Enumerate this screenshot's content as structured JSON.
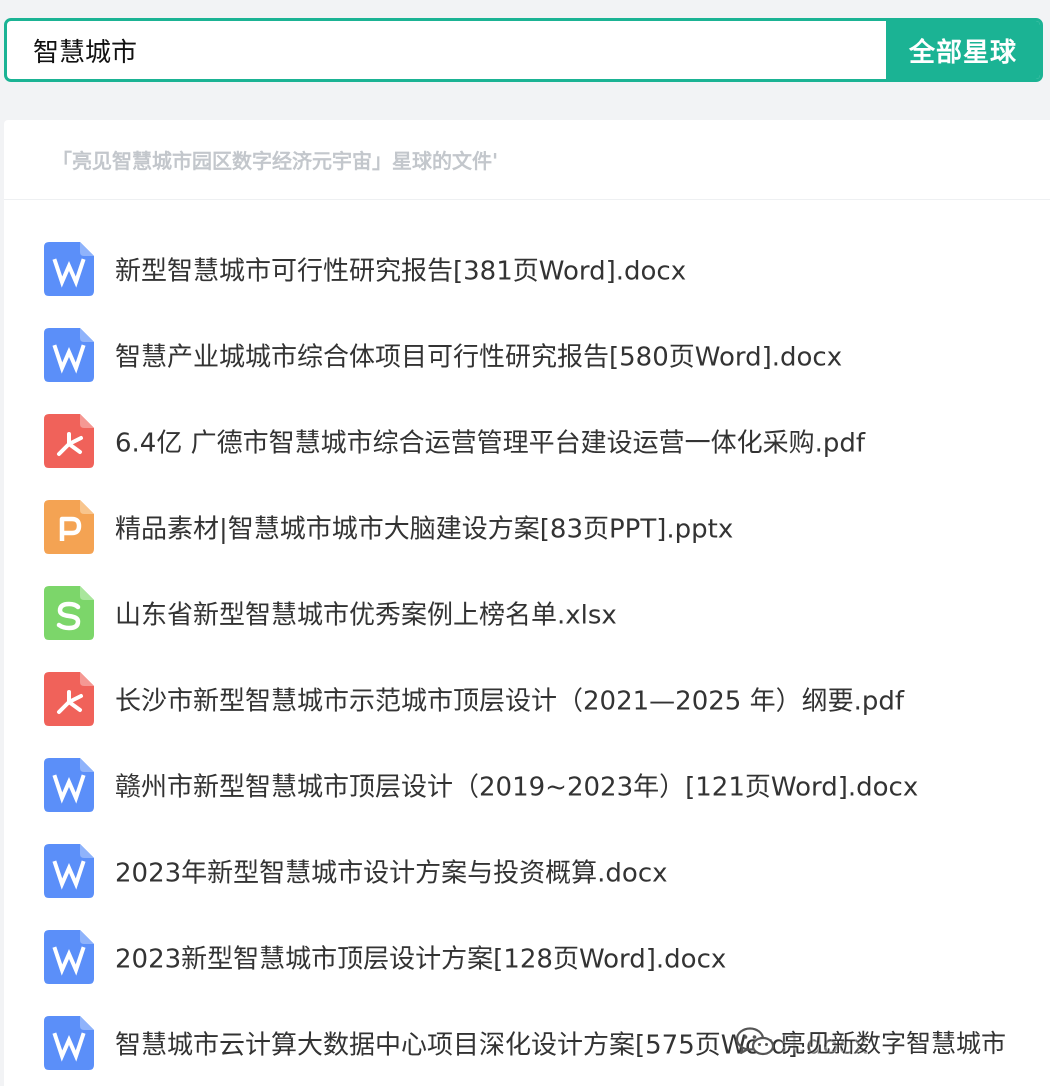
{
  "search": {
    "query": "智慧城市",
    "button_label": "全部星球"
  },
  "panel": {
    "title": "「亮见智慧城市园区数字经济元宇宙」星球的文件'"
  },
  "files": [
    {
      "name": "新型智慧城市可行性研究报告[381页Word].docx",
      "type": "word",
      "icon": "word-icon"
    },
    {
      "name": "智慧产业城城市综合体项目可行性研究报告[580页Word].docx",
      "type": "word",
      "icon": "word-icon"
    },
    {
      "name": "6.4亿 广德市智慧城市综合运营管理平台建设运营一体化采购.pdf",
      "type": "pdf",
      "icon": "pdf-icon"
    },
    {
      "name": "精品素材|智慧城市城市大脑建设方案[83页PPT].pptx",
      "type": "ppt",
      "icon": "ppt-icon"
    },
    {
      "name": "山东省新型智慧城市优秀案例上榜名单.xlsx",
      "type": "excel",
      "icon": "excel-icon"
    },
    {
      "name": "长沙市新型智慧城市示范城市顶层设计（2021—2025 年）纲要.pdf",
      "type": "pdf",
      "icon": "pdf-icon"
    },
    {
      "name": "赣州市新型智慧城市顶层设计（2019~2023年）[121页Word].docx",
      "type": "word",
      "icon": "word-icon"
    },
    {
      "name": "2023年新型智慧城市设计方案与投资概算.docx",
      "type": "word",
      "icon": "word-icon"
    },
    {
      "name": "2023新型智慧城市顶层设计方案[128页Word].docx",
      "type": "word",
      "icon": "word-icon"
    },
    {
      "name": "智慧城市云计算大数据中心项目深化设计方案[575页Word].docx",
      "type": "word",
      "icon": "word-icon"
    }
  ],
  "watermark": {
    "text": "亮见新数字智慧城市",
    "icon": "wechat-icon"
  },
  "colors": {
    "accent": "#1bb394",
    "word": "#5b8ff9",
    "pdf": "#f0625a",
    "ppt": "#f4a353",
    "excel": "#7cd66a"
  }
}
